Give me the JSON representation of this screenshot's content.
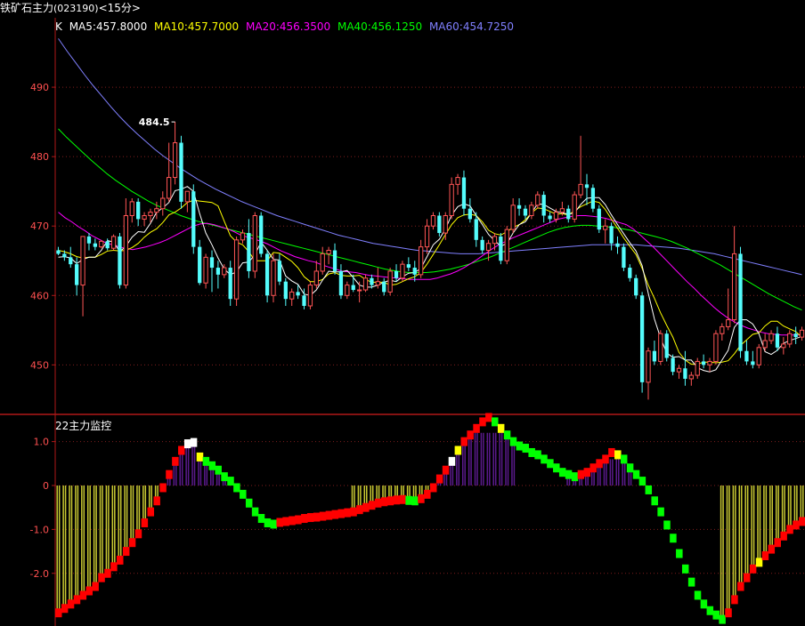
{
  "window": {
    "title": "铁矿石主力",
    "code": "(023190)",
    "period": "<15分>"
  },
  "main_panel": {
    "k_label": "K",
    "ma_legend": [
      {
        "text": "MA5:457.8000",
        "color": "#FFFFFF"
      },
      {
        "text": "MA10:457.7000",
        "color": "#FFFF00"
      },
      {
        "text": "MA20:456.3500",
        "color": "#FF00FF"
      },
      {
        "text": "MA40:456.1250",
        "color": "#00FF00"
      },
      {
        "text": "MA60:454.7250",
        "color": "#8080FF"
      }
    ],
    "y_ticks": [
      "490",
      "480",
      "470",
      "460",
      "450"
    ],
    "high_marker": "484.5"
  },
  "indicator_panel": {
    "title": "22主力监控",
    "y_ticks": [
      "1.0",
      "0",
      "-1.0",
      "-2.0"
    ]
  },
  "colors": {
    "up": "#FF5555",
    "down": "#54FCFC",
    "grid": "#7F1E1E",
    "axis": "#B01818",
    "tick_text": "#FF5050",
    "yellow_bar": "#C8C832",
    "purple_bar": "#5A1A8C",
    "red_block": "#FF0000",
    "green_block": "#00FF00",
    "yellow_block": "#FFFF00",
    "white_block": "#FFFFFF"
  },
  "chart_data": {
    "type": "candlestick",
    "ylim": [
      443,
      500
    ],
    "candles": [
      [
        466.5,
        467,
        465.8,
        466
      ],
      [
        466,
        466.5,
        465,
        465.5
      ],
      [
        465.5,
        467,
        464,
        464.5
      ],
      [
        464.5,
        465.5,
        460,
        461.5
      ],
      [
        461.5,
        467,
        457,
        468.5
      ],
      [
        468.5,
        469,
        466.5,
        467.5
      ],
      [
        467.5,
        468.2,
        466.5,
        467
      ],
      [
        467,
        468,
        466.8,
        467.8
      ],
      [
        467.8,
        468.2,
        466.5,
        466.8
      ],
      [
        466.8,
        468.8,
        466.5,
        468.5
      ],
      [
        468.5,
        469,
        461,
        461.5
      ],
      [
        461.5,
        474,
        461,
        471.5
      ],
      [
        471.5,
        474,
        470.5,
        473.5
      ],
      [
        473.5,
        474,
        470,
        471
      ],
      [
        471,
        472,
        470,
        471.5
      ],
      [
        471.5,
        472.5,
        470.5,
        472
      ],
      [
        472,
        473.5,
        471,
        472.5
      ],
      [
        472.5,
        475,
        471.5,
        474
      ],
      [
        474,
        482,
        473.5,
        477
      ],
      [
        477,
        485,
        476,
        482
      ],
      [
        482,
        483,
        472.5,
        473.5
      ],
      [
        473.5,
        475,
        472,
        475
      ],
      [
        475,
        476,
        466,
        467
      ],
      [
        467,
        468,
        461.5,
        461.8
      ],
      [
        461.8,
        466,
        461,
        465.5
      ],
      [
        465.5,
        466.5,
        460.5,
        464
      ],
      [
        464,
        465,
        461,
        463
      ],
      [
        463,
        464.5,
        462.5,
        464
      ],
      [
        464,
        465,
        458.5,
        459.5
      ],
      [
        459.5,
        468.5,
        458.5,
        468
      ],
      [
        468,
        469.5,
        467.5,
        469
      ],
      [
        469,
        471,
        462.5,
        463.5
      ],
      [
        463.5,
        472,
        462.5,
        471.5
      ],
      [
        471.5,
        472,
        465.5,
        466
      ],
      [
        466,
        466.5,
        459,
        460
      ],
      [
        460,
        466,
        459,
        465
      ],
      [
        465,
        466,
        461.5,
        462
      ],
      [
        462,
        462.5,
        458.5,
        459.5
      ],
      [
        459.5,
        461,
        458.5,
        460.5
      ],
      [
        460.5,
        461.5,
        459.5,
        460
      ],
      [
        460,
        461,
        458,
        458.5
      ],
      [
        458.5,
        462,
        458,
        461.5
      ],
      [
        461.5,
        465,
        461,
        463.5
      ],
      [
        463.5,
        467,
        463,
        466
      ],
      [
        466,
        467,
        464.5,
        466.5
      ],
      [
        466.5,
        467.5,
        463,
        463.5
      ],
      [
        463.5,
        464.5,
        459.5,
        460
      ],
      [
        460,
        462,
        459.5,
        461.5
      ],
      [
        461.5,
        463,
        460.5,
        460.8
      ],
      [
        460.8,
        462,
        459,
        460.8
      ],
      [
        460.8,
        463,
        460.5,
        462.5
      ],
      [
        462.5,
        463,
        461,
        461.5
      ],
      [
        461.5,
        464,
        461,
        462
      ],
      [
        462,
        462.5,
        460,
        460.5
      ],
      [
        460.5,
        464,
        460,
        463.5
      ],
      [
        463.5,
        464.5,
        462,
        462.5
      ],
      [
        462.5,
        465,
        462,
        464.5
      ],
      [
        464.5,
        465.5,
        463.5,
        464
      ],
      [
        464,
        465,
        462,
        463
      ],
      [
        463,
        468,
        462.5,
        467
      ],
      [
        467,
        471,
        466,
        470
      ],
      [
        470,
        472,
        469.5,
        471.5
      ],
      [
        471.5,
        472,
        468.5,
        469
      ],
      [
        469,
        472,
        468,
        471.5
      ],
      [
        471.5,
        477,
        471,
        476
      ],
      [
        476,
        477.5,
        474.5,
        477
      ],
      [
        477,
        478,
        471.5,
        472.5
      ],
      [
        472.5,
        474,
        470.5,
        471
      ],
      [
        471,
        472,
        467,
        468
      ],
      [
        468,
        468.5,
        466,
        466.5
      ],
      [
        466.5,
        468,
        465,
        467.5
      ],
      [
        467.5,
        469,
        466.5,
        468.5
      ],
      [
        468.5,
        469,
        464.5,
        465
      ],
      [
        465,
        470,
        464.5,
        469.5
      ],
      [
        469.5,
        474,
        469,
        473
      ],
      [
        473,
        474,
        471.5,
        472.5
      ],
      [
        472.5,
        473,
        471,
        471.5
      ],
      [
        471.5,
        473.5,
        471,
        473
      ],
      [
        473,
        475,
        472.5,
        474.5
      ],
      [
        474.5,
        475,
        470.5,
        471.5
      ],
      [
        471.5,
        472,
        470.5,
        471
      ],
      [
        471,
        472.5,
        470.5,
        472
      ],
      [
        472,
        473.5,
        471.5,
        472.5
      ],
      [
        472.5,
        473,
        470.5,
        471
      ],
      [
        471,
        475,
        470.5,
        474.5
      ],
      [
        474.5,
        483,
        474,
        476
      ],
      [
        476,
        477.5,
        473,
        475.5
      ],
      [
        475.5,
        476,
        472,
        472.5
      ],
      [
        472.5,
        473,
        469,
        469.5
      ],
      [
        469.5,
        471,
        467.5,
        470
      ],
      [
        470,
        470.5,
        466.5,
        467.5
      ],
      [
        467.5,
        468.5,
        466,
        467
      ],
      [
        467,
        467.5,
        463.5,
        464
      ],
      [
        464,
        464.5,
        462,
        462.5
      ],
      [
        462.5,
        463,
        459.5,
        460
      ],
      [
        460,
        460.5,
        446,
        447.5
      ],
      [
        447.5,
        452.5,
        445,
        452
      ],
      [
        452,
        453.5,
        450,
        450.5
      ],
      [
        450.5,
        455,
        450,
        454.5
      ],
      [
        454.5,
        455,
        450.5,
        451
      ],
      [
        451,
        451.5,
        448.5,
        449
      ],
      [
        449,
        450,
        448,
        449.5
      ],
      [
        449.5,
        452,
        447,
        448
      ],
      [
        448,
        449,
        447,
        448.5
      ],
      [
        448.5,
        451,
        448,
        450.5
      ],
      [
        450.5,
        451.5,
        449.5,
        450
      ],
      [
        450,
        451,
        449,
        450.5
      ],
      [
        450.5,
        455,
        450,
        454.5
      ],
      [
        454.5,
        456,
        453.5,
        455.5
      ],
      [
        455.5,
        461,
        455,
        456.5
      ],
      [
        456.5,
        470,
        456,
        466
      ],
      [
        466,
        467,
        451,
        452
      ],
      [
        452,
        453.5,
        450,
        450.5
      ],
      [
        450.5,
        452,
        449.5,
        450
      ],
      [
        450,
        453,
        449.5,
        452.5
      ],
      [
        452.5,
        454.5,
        452,
        453.5
      ],
      [
        453.5,
        455,
        453,
        454.5
      ],
      [
        454.5,
        455.5,
        452,
        452.5
      ],
      [
        452.5,
        454,
        451.5,
        453
      ],
      [
        453,
        455,
        452.5,
        454.5
      ],
      [
        454.5,
        455.5,
        453,
        454
      ],
      [
        454,
        455.5,
        453.5,
        455
      ]
    ],
    "ma5": [
      465.5,
      465.6,
      465.4,
      464.6,
      465.2,
      465.5,
      465.5,
      466.5,
      467.9,
      467.7,
      466.3,
      467.1,
      468.4,
      469.2,
      469.1,
      470.4,
      472.0,
      472.6,
      473.4,
      475.1,
      475.3,
      475.7,
      475.0,
      471.8,
      469.0,
      467.3,
      465.4,
      463.8,
      463.0,
      463.4,
      464.7,
      464.8,
      465.9,
      467.7,
      466.5,
      465.2,
      465.1,
      462.8,
      462.1,
      461.6,
      460.2,
      460.0,
      460.8,
      462.2,
      463.5,
      463.4,
      463.4,
      463.6,
      462.6,
      461.5,
      461.2,
      461.2,
      461.5,
      461.9,
      462.2,
      462.0,
      462.7,
      463.2,
      463.3,
      463.9,
      465.6,
      467.3,
      468.1,
      469.6,
      471.6,
      472.8,
      473.2,
      472.9,
      471.5,
      470.2,
      468.8,
      467.9,
      467.1,
      467.5,
      469.0,
      470.2,
      470.6,
      471.9,
      473.2,
      473.1,
      472.6,
      472.1,
      471.9,
      471.7,
      471.9,
      473.1,
      474.0,
      474.1,
      474.1,
      473.1,
      471.6,
      470.2,
      468.9,
      467.6,
      466.4,
      464.3,
      460.3,
      456.6,
      453.9,
      451.7,
      451.1,
      451.2,
      450.7,
      450.7,
      449.6,
      449.2,
      449.0,
      449.3,
      450.7,
      452.1,
      455.4,
      456.5,
      456.5,
      455.9,
      454.5,
      451.9,
      451.5,
      452.1,
      453.1,
      453.5,
      453.8,
      454.1
    ],
    "ma10": [
      466.5,
      466.3,
      466.0,
      465.6,
      465.4,
      465.5,
      465.5,
      465.9,
      466.4,
      466.5,
      466.4,
      466.5,
      466.9,
      467.5,
      468.4,
      469.1,
      469.6,
      470.5,
      471.6,
      472.0,
      472.6,
      473.4,
      473.7,
      473.6,
      473.5,
      473.4,
      472.9,
      470.7,
      468.6,
      467.7,
      467.3,
      466.3,
      465.0,
      465.0,
      465.0,
      466.2,
      466.1,
      465.5,
      464.9,
      464.0,
      462.7,
      462.0,
      462.0,
      462.3,
      463.1,
      463.3,
      462.9,
      462.8,
      462.8,
      462.9,
      462.3,
      461.9,
      461.9,
      461.9,
      461.5,
      461.6,
      462.0,
      462.4,
      462.7,
      463.3,
      464.5,
      465.9,
      467.3,
      468.8,
      470.2,
      471.2,
      471.6,
      471.7,
      471.5,
      470.6,
      469.4,
      468.9,
      468.7,
      469.2,
      469.8,
      470.2,
      470.9,
      471.9,
      472.6,
      472.5,
      472.1,
      471.7,
      471.8,
      471.6,
      472.2,
      472.8,
      473.2,
      473.6,
      473.4,
      472.4,
      471.0,
      469.7,
      468.3,
      467.1,
      465.9,
      463.9,
      461.5,
      459.6,
      457.5,
      455.7,
      454.0,
      451.8,
      450.7,
      450.1,
      450.1,
      450.4,
      450.4,
      450.3,
      450.4,
      450.6,
      451.6,
      452.8,
      453.6,
      454.4,
      454.6,
      455.6,
      456.3,
      456.3,
      455.6,
      455.2,
      454.8,
      454.0
    ],
    "ma20": [
      472,
      471.2,
      470.6,
      469.9,
      469.3,
      468.6,
      468.1,
      467.6,
      467.3,
      467.0,
      466.8,
      466.6,
      466.8,
      467.0,
      467.3,
      467.6,
      468.0,
      468.5,
      469.0,
      469.5,
      470.0,
      470.3,
      470.4,
      470.2,
      469.9,
      469.6,
      469.2,
      468.7,
      468.4,
      468.1,
      467.8,
      467.4,
      466.9,
      466.4,
      466.0,
      465.6,
      465.3,
      465.0,
      464.8,
      464.4,
      464.1,
      463.8,
      463.5,
      463.4,
      463.3,
      463.1,
      462.9,
      462.8,
      462.7,
      462.6,
      462.5,
      462.4,
      462.3,
      462.3,
      462.3,
      462.3,
      462.5,
      462.8,
      463.1,
      463.5,
      464.0,
      464.6,
      465.2,
      465.9,
      466.6,
      467.2,
      467.7,
      468.2,
      468.6,
      469.0,
      469.4,
      469.8,
      470.2,
      470.6,
      471.0,
      471.2,
      471.4,
      471.5,
      471.5,
      471.4,
      471.3,
      471.1,
      470.8,
      470.5,
      470.2,
      469.6,
      468.8,
      467.9,
      467.0,
      466.0,
      465.0,
      464.0,
      463.0,
      462.0,
      461.1,
      460.1,
      459.2,
      458.3,
      457.5,
      456.8,
      456.2,
      455.7,
      455.3,
      455.0,
      454.7,
      454.5,
      454.4,
      454.3,
      454.3,
      454.3,
      454.3
    ],
    "ma40": [
      484,
      482.8,
      481.7,
      480.6,
      479.5,
      478.5,
      477.5,
      476.6,
      475.8,
      475.0,
      474.3,
      473.6,
      473.0,
      472.5,
      472.0,
      471.5,
      471.1,
      470.7,
      470.4,
      470.1,
      469.8,
      469.5,
      469.2,
      468.9,
      468.6,
      468.3,
      468.0,
      467.7,
      467.4,
      467.1,
      466.8,
      466.5,
      466.2,
      465.9,
      465.6,
      465.3,
      465.0,
      464.7,
      464.4,
      464.1,
      463.8,
      463.6,
      463.4,
      463.3,
      463.3,
      463.3,
      463.4,
      463.6,
      463.8,
      464.1,
      464.4,
      464.8,
      465.2,
      465.6,
      466.1,
      466.6,
      467.1,
      467.6,
      468.1,
      468.6,
      469.1,
      469.5,
      469.8,
      470.0,
      470.1,
      470.1,
      470.0,
      469.9,
      469.8,
      469.6,
      469.4,
      469.1,
      468.8,
      468.5,
      468.2,
      467.8,
      467.3,
      466.8,
      466.2,
      465.6,
      465.0,
      464.4,
      463.7,
      463.0,
      462.3,
      461.6,
      460.9,
      460.2,
      459.6,
      459.0,
      458.4,
      457.9
    ],
    "ma60": [
      497,
      495.2,
      493.5,
      491.8,
      490.2,
      488.7,
      487.2,
      485.8,
      484.5,
      483.3,
      482.2,
      481.1,
      480.1,
      479.2,
      478.3,
      477.5,
      476.7,
      476.0,
      475.3,
      474.7,
      474.1,
      473.5,
      473.0,
      472.5,
      472.0,
      471.5,
      471.1,
      470.7,
      470.3,
      469.9,
      469.5,
      469.1,
      468.7,
      468.4,
      468.1,
      467.8,
      467.5,
      467.3,
      467.1,
      466.9,
      466.7,
      466.5,
      466.4,
      466.3,
      466.2,
      466.1,
      466.0,
      466.0,
      466.0,
      466.1,
      466.2,
      466.3,
      466.4,
      466.5,
      466.6,
      466.7,
      466.8,
      466.9,
      467.0,
      467.1,
      467.2,
      467.3,
      467.3,
      467.3,
      467.3,
      467.3,
      467.3,
      467.2,
      467.1,
      467.0,
      466.9,
      466.8,
      466.6,
      466.4,
      466.2,
      466.0,
      465.7,
      465.4,
      465.1,
      464.8,
      464.5,
      464.2,
      463.9,
      463.6,
      463.3,
      463.0
    ],
    "indicator": {
      "ylim": [
        -3.2,
        1.6
      ],
      "line": [
        -2.9,
        -2.8,
        -2.7,
        -2.6,
        -2.5,
        -2.4,
        -2.3,
        -2.1,
        -2.0,
        -1.85,
        -1.7,
        -1.5,
        -1.3,
        -1.1,
        -0.85,
        -0.6,
        -0.35,
        -0.05,
        0.25,
        0.55,
        0.8,
        0.95,
        0.98,
        0.65,
        0.55,
        0.45,
        0.35,
        0.2,
        0.1,
        -0.05,
        -0.2,
        -0.4,
        -0.6,
        -0.75,
        -0.85,
        -0.88,
        -0.84,
        -0.82,
        -0.8,
        -0.78,
        -0.75,
        -0.73,
        -0.72,
        -0.7,
        -0.68,
        -0.66,
        -0.64,
        -0.62,
        -0.6,
        -0.55,
        -0.5,
        -0.45,
        -0.4,
        -0.37,
        -0.35,
        -0.33,
        -0.32,
        -0.34,
        -0.35,
        -0.3,
        -0.2,
        -0.05,
        0.15,
        0.35,
        0.55,
        0.8,
        1.0,
        1.15,
        1.3,
        1.45,
        1.55,
        1.45,
        1.3,
        1.15,
        1.0,
        0.9,
        0.85,
        0.75,
        0.7,
        0.6,
        0.5,
        0.4,
        0.3,
        0.25,
        0.2,
        0.25,
        0.3,
        0.4,
        0.5,
        0.6,
        0.75,
        0.7,
        0.6,
        0.4,
        0.25,
        0.1,
        -0.1,
        -0.35,
        -0.6,
        -0.9,
        -1.2,
        -1.55,
        -1.9,
        -2.2,
        -2.5,
        -2.7,
        -2.85,
        -2.95,
        -3.05,
        -2.9,
        -2.6,
        -2.3,
        -2.1,
        -1.9,
        -1.75,
        -1.6,
        -1.45,
        -1.3,
        -1.15,
        -1.0,
        -0.9,
        -0.82
      ],
      "bar_ranges": [
        [
          0,
          23,
          -2.85,
          "y"
        ],
        [
          18,
          36,
          0.9,
          "p"
        ],
        [
          59,
          74,
          1.2,
          "p"
        ],
        [
          83,
          93,
          0.6,
          "p"
        ],
        [
          48,
          61,
          -0.5,
          "y2"
        ],
        [
          108,
          121,
          -0.9,
          "y3"
        ]
      ]
    }
  }
}
